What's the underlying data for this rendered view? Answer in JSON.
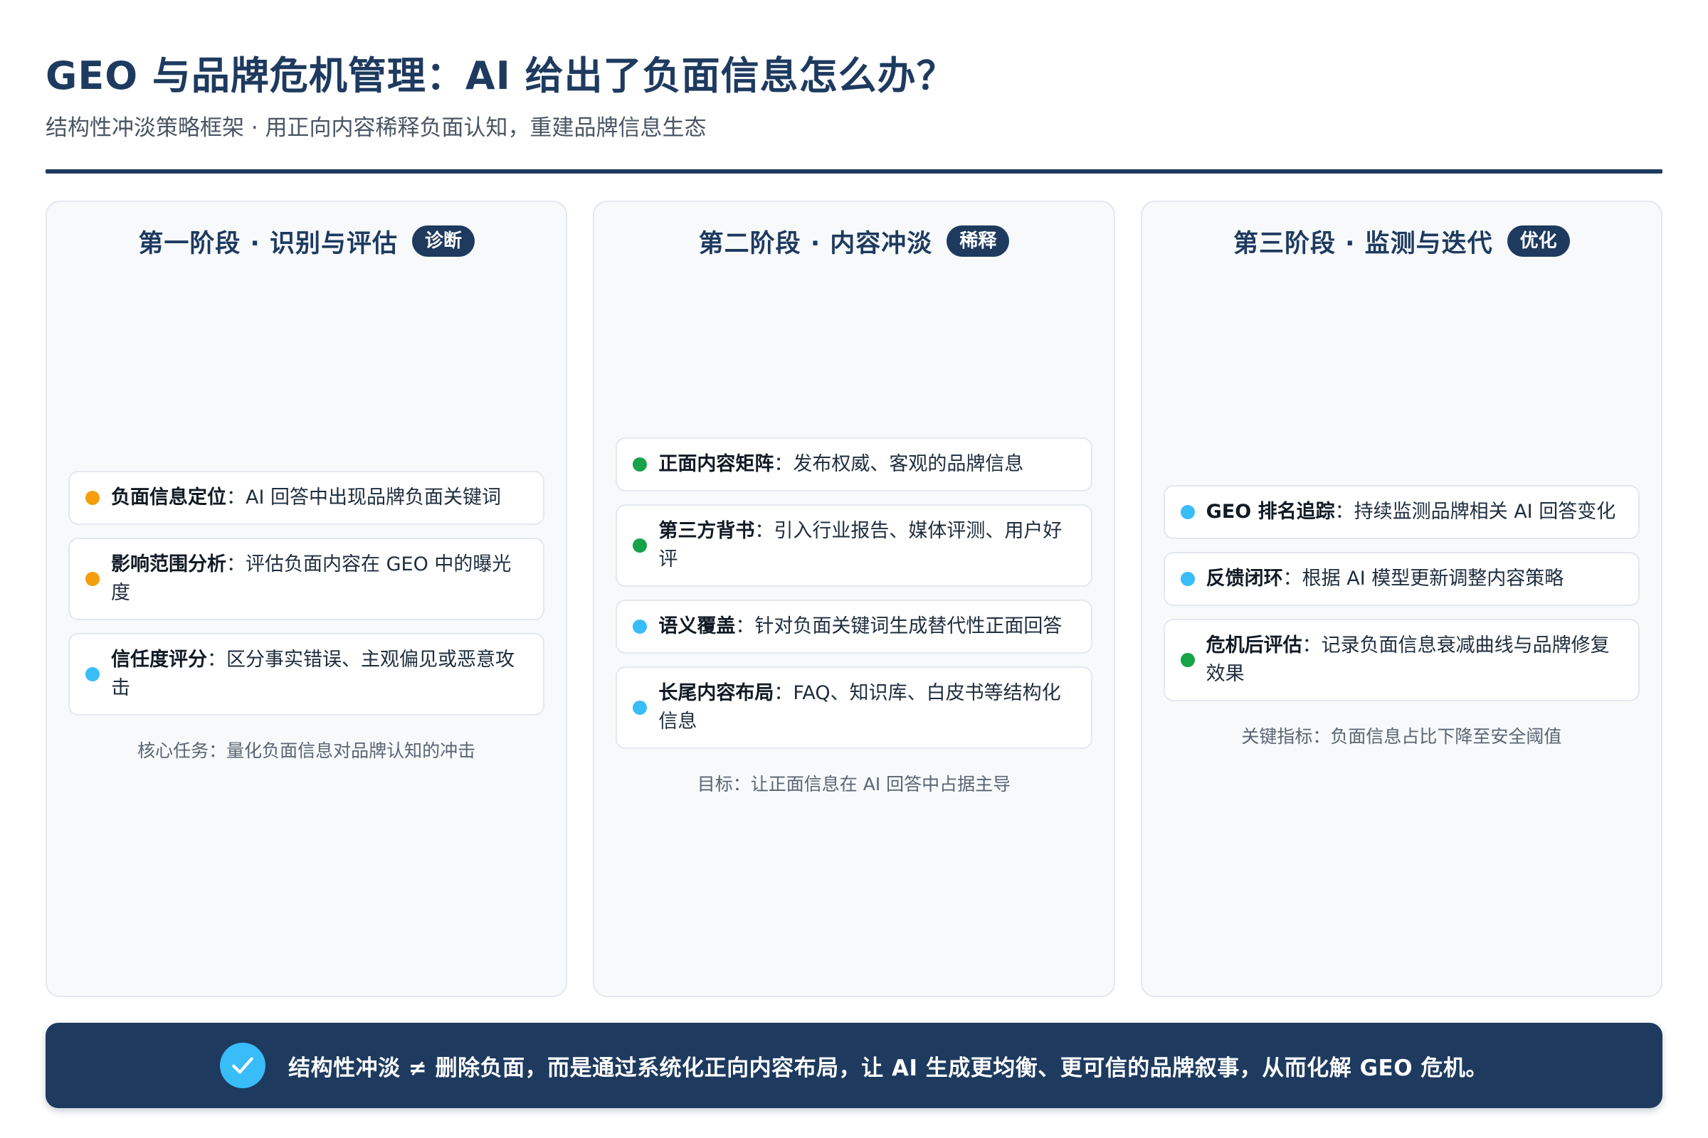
{
  "header": {
    "title": "GEO 与品牌危机管理：AI 给出了负面信息怎么办？",
    "subtitle": "结构性冲淡策略框架 · 用正向内容稀释负面认知，重建品牌信息生态"
  },
  "colors": {
    "primary": "#1e3a5f",
    "orange": "#f59e0b",
    "blue": "#38bdf8",
    "green": "#16a34a"
  },
  "columns": [
    {
      "title": "第一阶段 · 识别与评估",
      "badge": "诊断",
      "items": [
        {
          "label": "负面信息定位",
          "sep": "：",
          "desc": "AI 回答中出现品牌负面关键词",
          "dot": "orange"
        },
        {
          "label": "影响范围分析",
          "sep": "：",
          "desc": "评估负面内容在 GEO 中的曝光度",
          "dot": "orange"
        },
        {
          "label": "信任度评分",
          "sep": "：",
          "desc": "区分事实错误、主观偏见或恶意攻击",
          "dot": "blue"
        }
      ],
      "note": "核心任务：量化负面信息对品牌认知的冲击"
    },
    {
      "title": "第二阶段 · 内容冲淡",
      "badge": "稀释",
      "items": [
        {
          "label": "正面内容矩阵",
          "sep": "：",
          "desc": "发布权威、客观的品牌信息",
          "dot": "green"
        },
        {
          "label": "第三方背书",
          "sep": "：",
          "desc": "引入行业报告、媒体评测、用户好评",
          "dot": "green"
        },
        {
          "label": "语义覆盖",
          "sep": "：",
          "desc": "针对负面关键词生成替代性正面回答",
          "dot": "blue"
        },
        {
          "label": "长尾内容布局",
          "sep": "：",
          "desc": "FAQ、知识库、白皮书等结构化信息",
          "dot": "blue"
        }
      ],
      "note": "目标：让正面信息在 AI 回答中占据主导"
    },
    {
      "title": "第三阶段 · 监测与迭代",
      "badge": "优化",
      "items": [
        {
          "label": "GEO 排名追踪",
          "sep": "：",
          "desc": "持续监测品牌相关 AI 回答变化",
          "dot": "blue"
        },
        {
          "label": "反馈闭环",
          "sep": "：",
          "desc": "根据 AI 模型更新调整内容策略",
          "dot": "blue"
        },
        {
          "label": "危机后评估",
          "sep": "：",
          "desc": "记录负面信息衰减曲线与品牌修复效果",
          "dot": "green"
        }
      ],
      "note": "关键指标：负面信息占比下降至安全阈值"
    }
  ],
  "banner": {
    "icon": "check-icon",
    "text": "结构性冲淡 ≠ 删除负面，而是通过系统化正向内容布局，让 AI 生成更均衡、更可信的品牌叙事，从而化解 GEO 危机。"
  }
}
